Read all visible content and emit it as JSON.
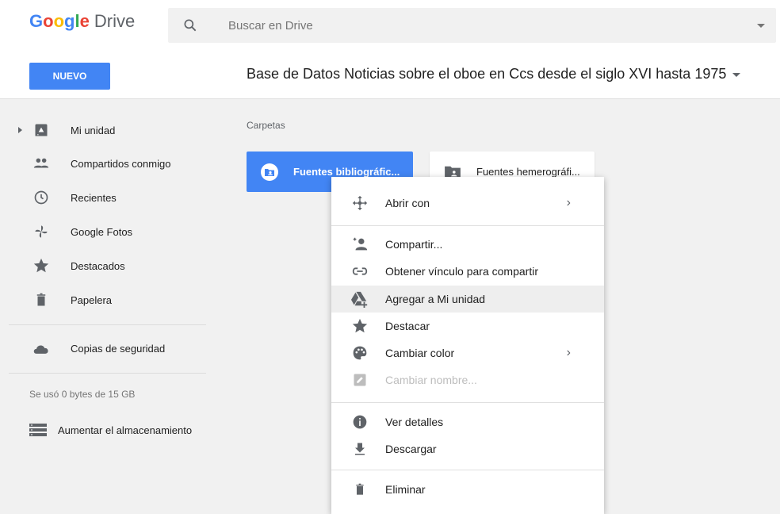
{
  "header": {
    "logo_google": "Google",
    "logo_drive": "Drive",
    "search_placeholder": "Buscar en Drive"
  },
  "toolbar": {
    "new_label": "NUEVO",
    "folder_title": "Base de Datos Noticias sobre el oboe en Ccs desde el siglo XVI hasta 1975"
  },
  "sidebar": {
    "items": [
      {
        "label": "Mi unidad",
        "icon": "drive-icon"
      },
      {
        "label": "Compartidos conmigo",
        "icon": "people-icon"
      },
      {
        "label": "Recientes",
        "icon": "clock-icon"
      },
      {
        "label": "Google Fotos",
        "icon": "pinwheel-icon"
      },
      {
        "label": "Destacados",
        "icon": "star-icon"
      },
      {
        "label": "Papelera",
        "icon": "trash-icon"
      }
    ],
    "backup_label": "Copias de seguridad",
    "usage": "Se usó 0 bytes de 15 GB",
    "upgrade_label": "Aumentar el almacenamiento"
  },
  "main": {
    "section_label": "Carpetas",
    "folders": [
      {
        "name": "Fuentes bibliográfic...",
        "selected": true
      },
      {
        "name": "Fuentes hemerográfi...",
        "selected": false
      }
    ]
  },
  "context_menu": {
    "items": [
      {
        "label": "Abrir con",
        "icon": "move-arrows-icon",
        "submenu": true
      },
      {
        "label": "Compartir...",
        "icon": "add-person-icon"
      },
      {
        "label": "Obtener vínculo para compartir",
        "icon": "link-icon"
      },
      {
        "label": "Agregar a Mi unidad",
        "icon": "drive-add-icon",
        "highlighted": true
      },
      {
        "label": "Destacar",
        "icon": "star-icon"
      },
      {
        "label": "Cambiar color",
        "icon": "palette-icon",
        "submenu": true
      },
      {
        "label": "Cambiar nombre...",
        "icon": "pencil-icon",
        "disabled": true
      },
      {
        "label": "Ver detalles",
        "icon": "info-icon"
      },
      {
        "label": "Descargar",
        "icon": "download-icon"
      },
      {
        "label": "Eliminar",
        "icon": "trash-icon"
      }
    ],
    "chevron": "›"
  },
  "colors": {
    "accent": "#4285f4",
    "text": "#212121",
    "icon": "#5f6368",
    "background": "#f1f1f1"
  }
}
